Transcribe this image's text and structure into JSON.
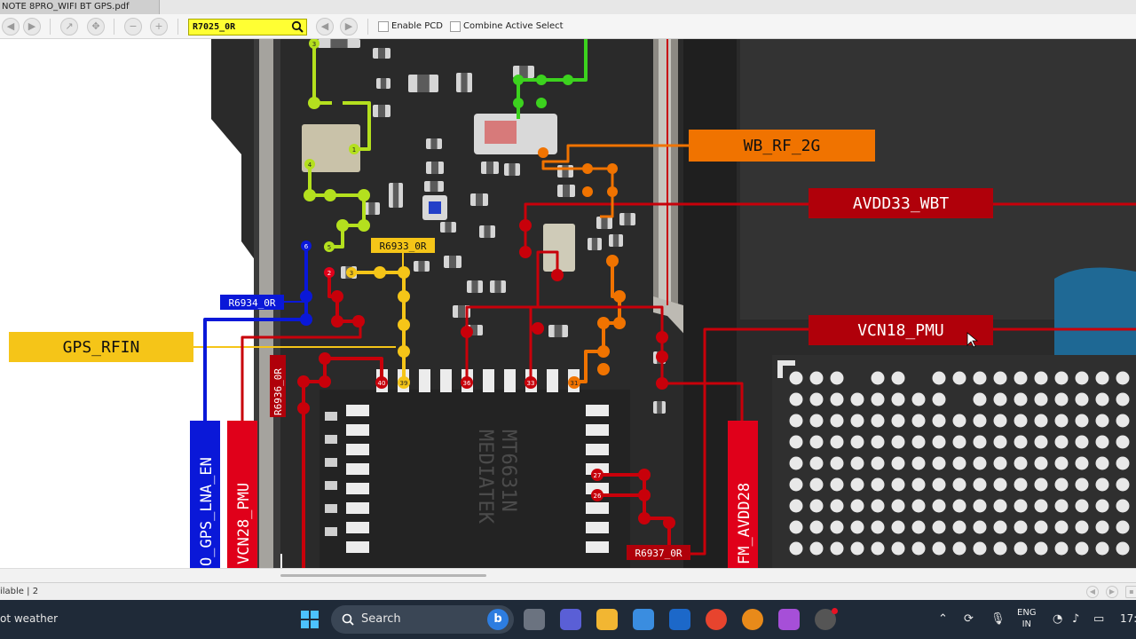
{
  "window": {
    "tab_title": "NOTE 8PRO_WIFI BT GPS.pdf"
  },
  "toolbar": {
    "search_value": "R7025_0R",
    "enable_pcd_label": "Enable PCD",
    "combine_active_select_label": "Combine Active Select"
  },
  "schematic": {
    "net_labels": {
      "gps_rfin": "GPS_RFIN",
      "wb_rf_2g": "WB_RF_2G",
      "avdd33_wbt": "AVDD33_WBT",
      "vcn18_pmu": "VCN18_PMU",
      "gps_lna_en": "O_GPS_LNA_EN",
      "vcn28_pmu": "VCN28_PMU",
      "fm_avdd28": "FM_AVDD28"
    },
    "part_labels": {
      "r6933": "R6933_0R",
      "r6934": "R6934_0R",
      "r6936": "R6936_0R",
      "r6937": "R6937_0R"
    },
    "pin_numbers": {
      "p3": "3",
      "p1": "1",
      "p4": "4",
      "p5": "5",
      "p6": "6",
      "p2": "2",
      "p40": "40",
      "p39": "39",
      "p36": "36",
      "p33": "33",
      "p31": "31",
      "p27": "27",
      "p26": "26"
    },
    "colors": {
      "red": "#c8000a",
      "orange": "#f07300",
      "yellow": "#f5c518",
      "lime": "#b4e01e",
      "green": "#3cd21e",
      "blue": "#0a18d8",
      "board": "#262626"
    }
  },
  "statusbar": {
    "text": "ilable | 2"
  },
  "taskbar": {
    "weather": "ot weather",
    "search_label": "Search",
    "language_top": "ENG",
    "language_bottom": "IN",
    "clock": "17:"
  }
}
